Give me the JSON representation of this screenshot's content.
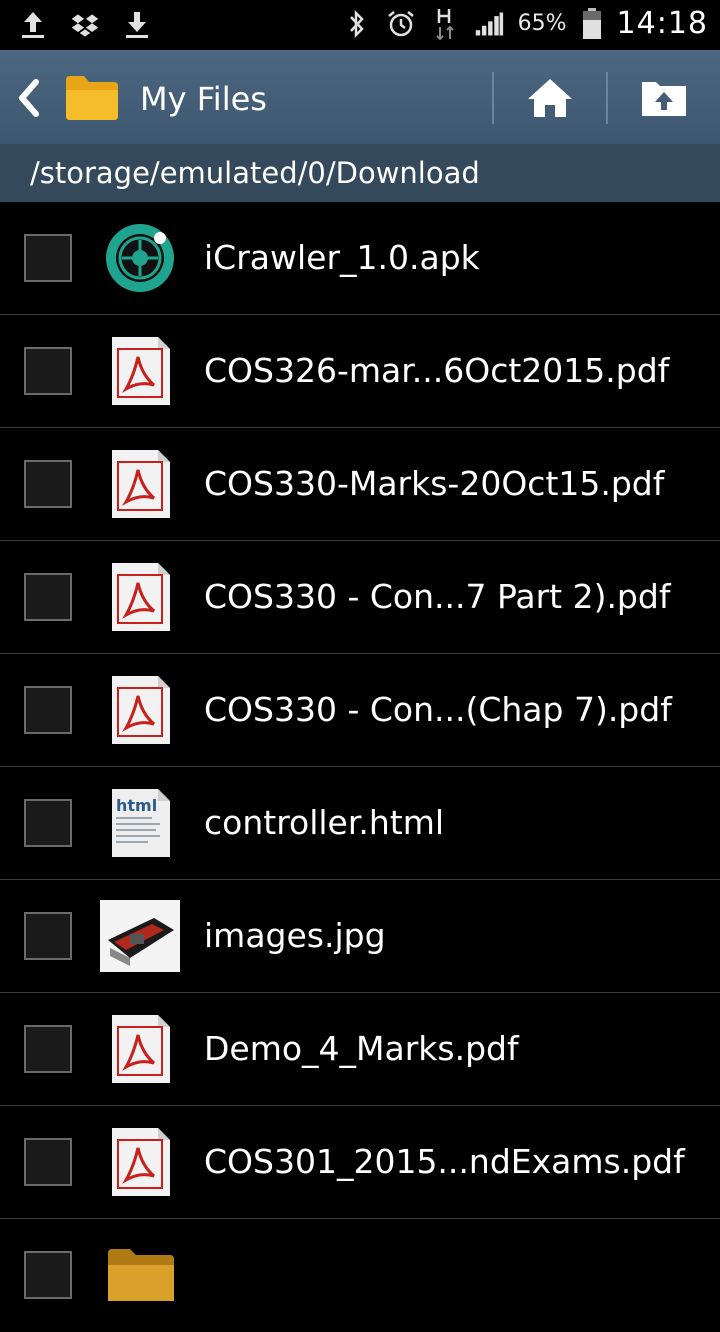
{
  "status_bar": {
    "left_icons": [
      "upload-icon",
      "dropbox-icon",
      "download-icon"
    ],
    "right_icons": [
      "bluetooth-icon",
      "alarm-icon",
      "data-h-icon",
      "signal-icon"
    ],
    "battery": "65%",
    "time": "14:18"
  },
  "action_bar": {
    "title": "My Files",
    "back_icon": "back-arrow-icon",
    "folder_icon": "folder-icon",
    "home_icon": "home-icon",
    "up_icon": "folder-up-icon",
    "color": "#435d76"
  },
  "path": "/storage/emulated/0/Download",
  "files": [
    {
      "name": "iCrawler_1.0.apk",
      "icon": "apk-icon"
    },
    {
      "name": "COS326-mar...6Oct2015.pdf",
      "icon": "pdf-icon"
    },
    {
      "name": "COS330-Marks-20Oct15.pdf",
      "icon": "pdf-icon"
    },
    {
      "name": "COS330 - Con...7 Part 2).pdf",
      "icon": "pdf-icon"
    },
    {
      "name": "COS330 - Con...(Chap 7).pdf",
      "icon": "pdf-icon"
    },
    {
      "name": "controller.html",
      "icon": "html-icon"
    },
    {
      "name": "images.jpg",
      "icon": "image-thumbnail-icon"
    },
    {
      "name": "Demo_4_Marks.pdf",
      "icon": "pdf-icon"
    },
    {
      "name": "COS301_2015...ndExams.pdf",
      "icon": "pdf-icon"
    }
  ]
}
